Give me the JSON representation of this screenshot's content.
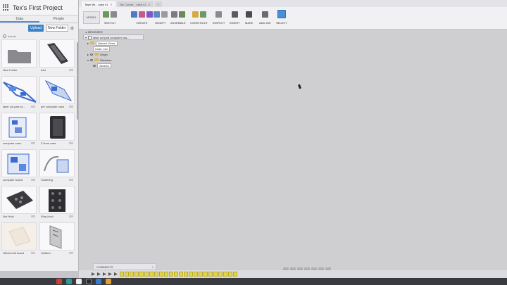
{
  "app": {
    "title": "Tex's First Project"
  },
  "left_panel": {
    "tabs": [
      "Data",
      "People"
    ],
    "upload_label": "Upload",
    "new_folder_label": "New Folder",
    "path": "Assets",
    "items": [
      {
        "name": "New Folder",
        "version": ""
      },
      {
        "name": "bad",
        "version": "V1"
      },
      {
        "name": "laser cut part co...",
        "version": "V2"
      },
      {
        "name": "pre computer case",
        "version": "V1"
      },
      {
        "name": "computer case",
        "version": "V1"
      },
      {
        "name": "2.0mm case",
        "version": "V1"
      },
      {
        "name": "computer board",
        "version": "V1"
      },
      {
        "name": "Soldering",
        "version": "V1"
      },
      {
        "name": "Nut Hold",
        "version": "V1"
      },
      {
        "name": "Ring Hold",
        "version": "V1"
      },
      {
        "name": "efficient lid board",
        "version": "V1"
      },
      {
        "name": "Untitled",
        "version": "V1"
      }
    ]
  },
  "tabs": [
    {
      "label": "Tasel Wi...   case v1",
      "active": true
    },
    {
      "label": "Tex Corner... case v1",
      "active": false
    }
  ],
  "toolbar": {
    "workspace": "MODEL",
    "groups": [
      "SKETCH",
      "CREATE",
      "MODIFY",
      "ASSEMBLE",
      "CONSTRUCT",
      "INSPECT",
      "INSERT",
      "MAKE",
      "ADD-INS",
      "SELECT"
    ]
  },
  "browser": {
    "header": "BROWSER",
    "root": "laser cut part computer cas...",
    "rows": [
      "Named Views",
      "Units: mm",
      "Origin",
      "Sketches",
      "Sketch1"
    ]
  },
  "bottom": {
    "comments_label": "COMMENTS"
  },
  "colors": {
    "accent": "#4a90d9",
    "sketch_line": "#4a4a9a",
    "profile_fill": "#f2e8de",
    "timeline_item": "#e3d54a"
  }
}
